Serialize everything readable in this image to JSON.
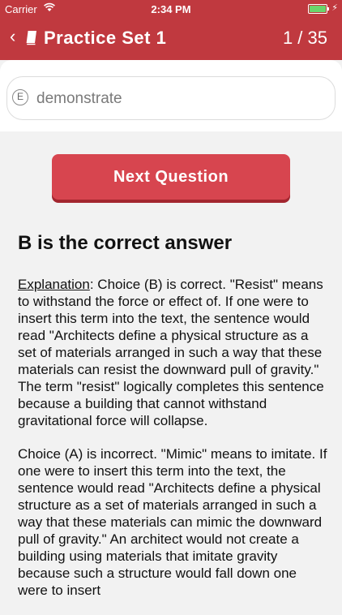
{
  "status_bar": {
    "carrier": "Carrier",
    "time": "2:34 PM",
    "battery_level": 1.0,
    "charging_icon": "bolt-icon"
  },
  "nav": {
    "back_icon": "chevron-left-icon",
    "book_icon": "book-icon",
    "title": "Practice Set 1",
    "counter": "1 / 35"
  },
  "answer_option": {
    "letter": "E",
    "text": "demonstrate"
  },
  "next_button_label": "Next Question",
  "result_heading": "B is the correct answer",
  "explanation": {
    "label": "Explanation",
    "first_paragraph": ": Choice (B) is correct. \"Resist\" means to withstand the force or effect of. If one were to insert this term into the text, the sentence would read \"Architects define a physical structure as a set of materials arranged in such a way that these materials can resist the downward pull of gravity.\" The term \"resist\" logically completes this sentence because a building that cannot withstand gravitational force will collapse.",
    "second_paragraph": "Choice (A) is incorrect. \"Mimic\" means to imitate. If one were to insert this term into the text, the sentence would read \"Architects define a physical structure as a set of materials arranged in such a way that these materials can mimic the downward pull of gravity.\" An architect would not create a building using materials that imitate gravity because such a structure would fall down one were to insert"
  },
  "colors": {
    "header": "#c0393f",
    "button": "#d7454f",
    "background": "#f2f2f2"
  }
}
